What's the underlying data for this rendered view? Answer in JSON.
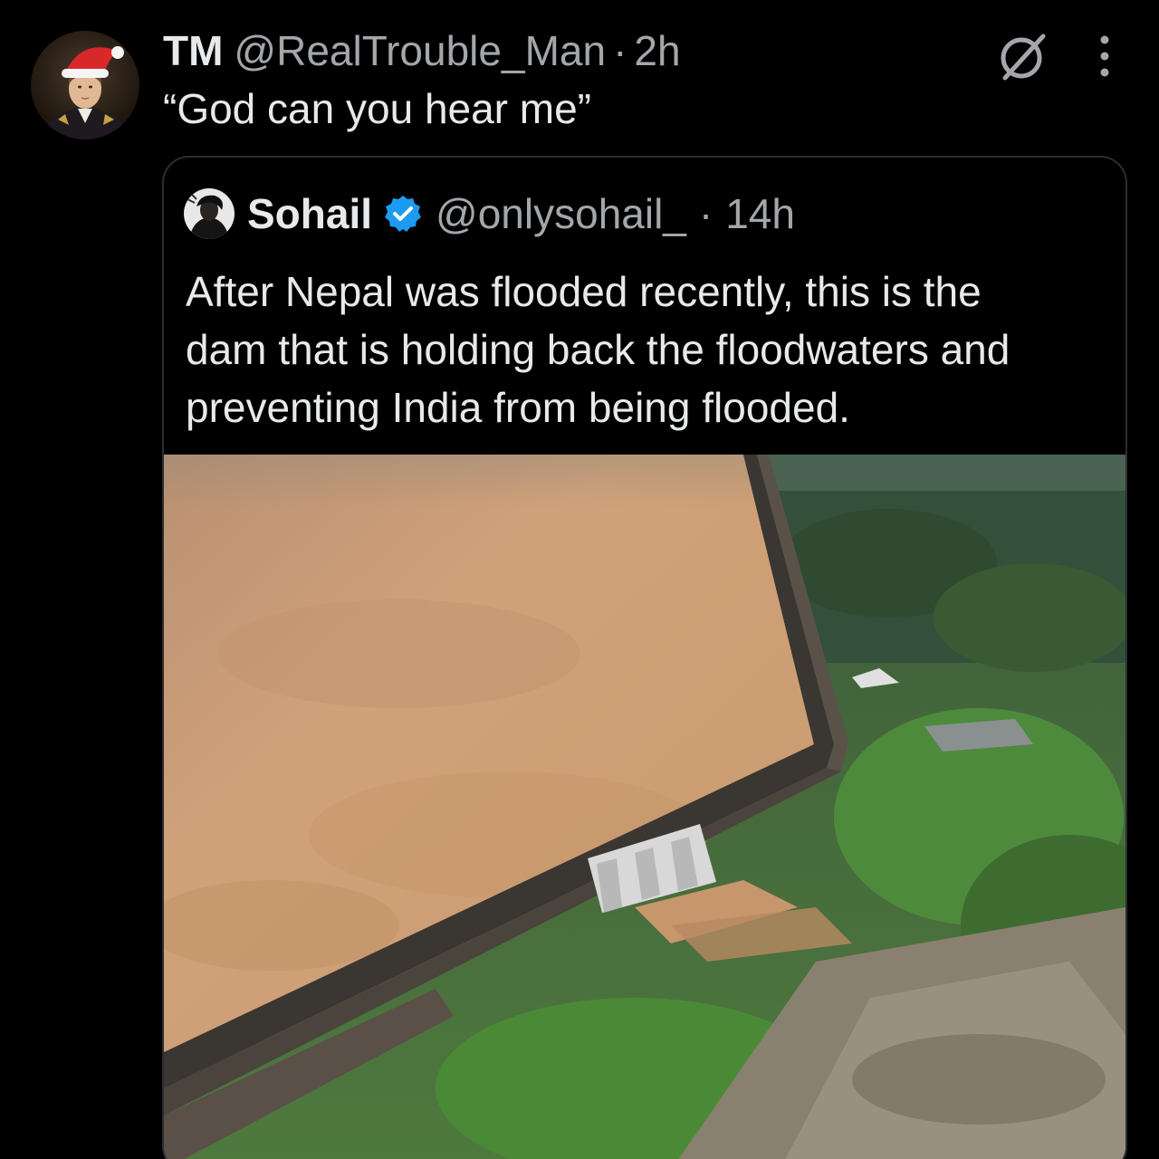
{
  "tweet": {
    "author_name": "TM",
    "handle": "@RealTrouble_Man",
    "separator": "·",
    "time": "2h",
    "text": "“God can you hear me”"
  },
  "quoted_tweet": {
    "author_name": "Sohail",
    "handle": "@onlysohail_",
    "separator": "·",
    "time": "14h",
    "text_lines": [
      "After Nepal was flooded recently, this is the",
      "dam that is holding back the floodwaters and",
      "preventing India from being flooded."
    ]
  },
  "icons": {
    "avatar": "avatar-portrait-santa-hat",
    "grok": "grok-icon",
    "more": "more-options-icon",
    "verified": "verified-badge-icon"
  },
  "colors": {
    "background": "#000000",
    "primary_text": "#e7e9ea",
    "secondary_text": "#a3a7ab",
    "border": "#2a2e32",
    "verified_blue": "#1d9bf0",
    "flood_water": "#c9986c"
  }
}
